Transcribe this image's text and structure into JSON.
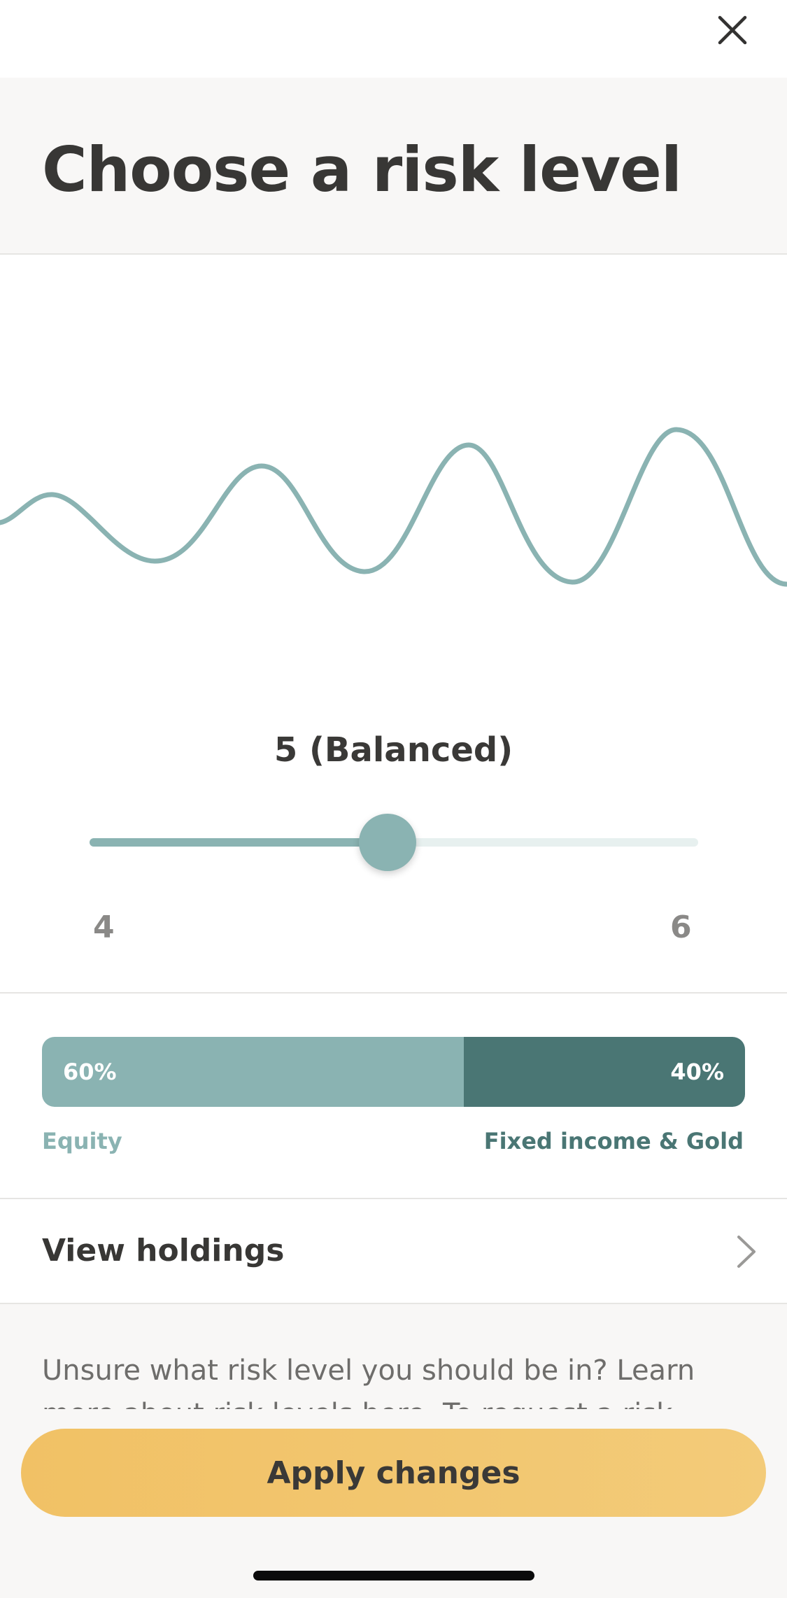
{
  "header": {
    "title": "Choose a risk level"
  },
  "colors": {
    "wave": "#8ab3b2",
    "equity": "#8ab3b2",
    "fixed_income": "#4a7674",
    "button": "#f1c165"
  },
  "risk": {
    "label": "5 (Balanced)",
    "min_label": "4",
    "max_label": "6",
    "slider_fraction": 0.49
  },
  "allocation": {
    "equity_percent": "60%",
    "equity_label": "Equity",
    "fixed_percent": "40%",
    "fixed_label": "Fixed income & Gold",
    "equity_fraction": 0.6
  },
  "holdings": {
    "label": "View holdings"
  },
  "info": {
    "text": "Unsure what risk level you should be in? Learn more about risk levels here. To request a risk score that's not"
  },
  "actions": {
    "apply_label": "Apply changes"
  },
  "icons": {
    "close": "close-icon",
    "chevron": "chevron-right-icon"
  }
}
